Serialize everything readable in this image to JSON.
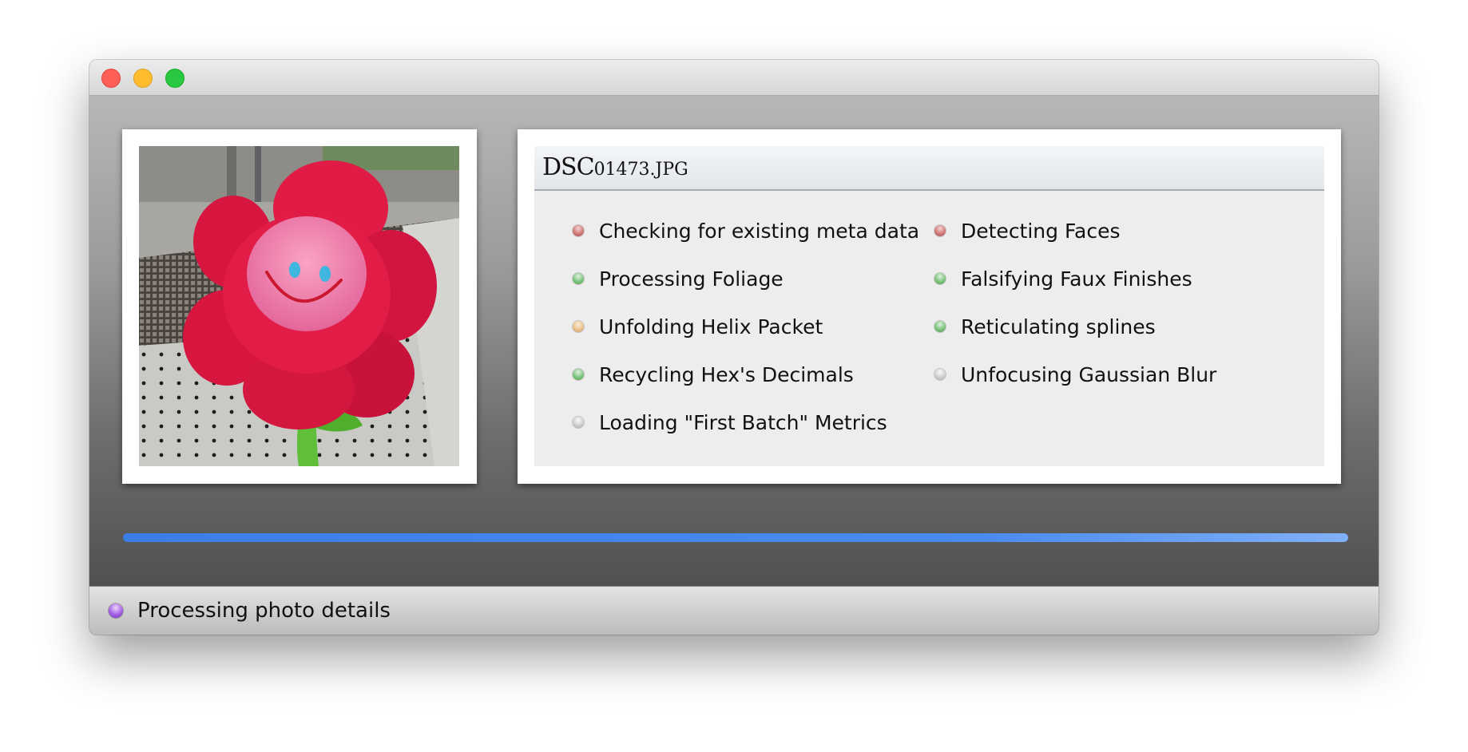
{
  "window": {
    "controls": {
      "close_icon": "close-traffic-light",
      "minimize_icon": "minimize-traffic-light",
      "zoom_icon": "zoom-traffic-light",
      "colors": {
        "close": "#fe5f57",
        "minimize": "#febc2e",
        "zoom": "#28c840"
      }
    }
  },
  "photo": {
    "subject": "red plush flower with a smiling pink face"
  },
  "details": {
    "filename_prefix": "DSC",
    "filename_suffix": "01473.JPG",
    "tasks": [
      {
        "label": "Checking for existing meta data",
        "status": "error"
      },
      {
        "label": "Processing Foliage",
        "status": "ok"
      },
      {
        "label": "Unfolding Helix Packet",
        "status": "warn"
      },
      {
        "label": "Recycling Hex's Decimals",
        "status": "ok"
      },
      {
        "label": "Loading \"First Batch\" Metrics",
        "status": "pending"
      },
      {
        "label": "Detecting Faces",
        "status": "error"
      },
      {
        "label": "Falsifying Faux Finishes",
        "status": "ok"
      },
      {
        "label": "Reticulating splines",
        "status": "ok"
      },
      {
        "label": "Unfocusing Gaussian Blur",
        "status": "pending"
      }
    ],
    "status_colors": {
      "error": "#c45f5f",
      "ok": "#6cb86c",
      "warn": "#e3b27c",
      "pending": "#c4c4c4"
    }
  },
  "progress": {
    "fraction": 1.0,
    "color": "#4a8bef"
  },
  "status": {
    "icon": "purple-status-dot",
    "text": "Processing photo details",
    "color": "#a661e6"
  }
}
